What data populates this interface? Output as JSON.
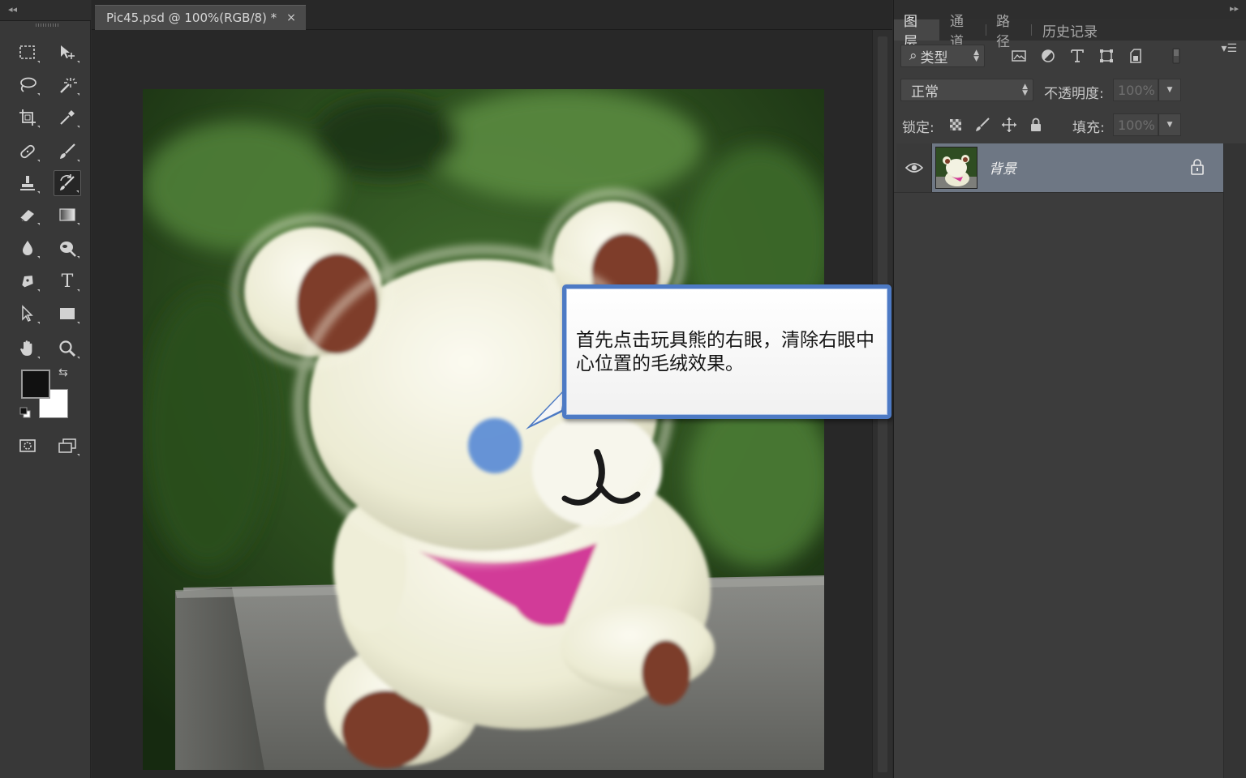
{
  "document": {
    "tab_title": "Pic45.psd @ 100%(RGB/8) *",
    "close_glyph": "×"
  },
  "toolbox": {
    "collapse_glyph": "◂◂",
    "type_tool_letter": "T",
    "swap_glyph": "⇆",
    "foreground_color": "#111111",
    "background_color": "#ffffff",
    "active_tool": "history-brush"
  },
  "callout": {
    "text": "首先点击玩具熊的右眼，清除右眼中心位置的毛绒效果。",
    "border_color": "#4d7ac4"
  },
  "panel": {
    "expand_glyph": "▸▸",
    "menu_glyph": "▾☰",
    "tabs": [
      {
        "label": "图层"
      },
      {
        "label": "通道"
      },
      {
        "label": "路径"
      },
      {
        "label": "历史记录"
      }
    ],
    "filter": {
      "icon": "⌕",
      "label": "类型"
    },
    "blend_mode": "正常",
    "opacity_label": "不透明度:",
    "opacity_value": "100%",
    "lock_label": "锁定:",
    "fill_label": "填充:",
    "fill_value": "100%",
    "layers": [
      {
        "name": "背景",
        "visible": true,
        "locked": true
      }
    ]
  }
}
